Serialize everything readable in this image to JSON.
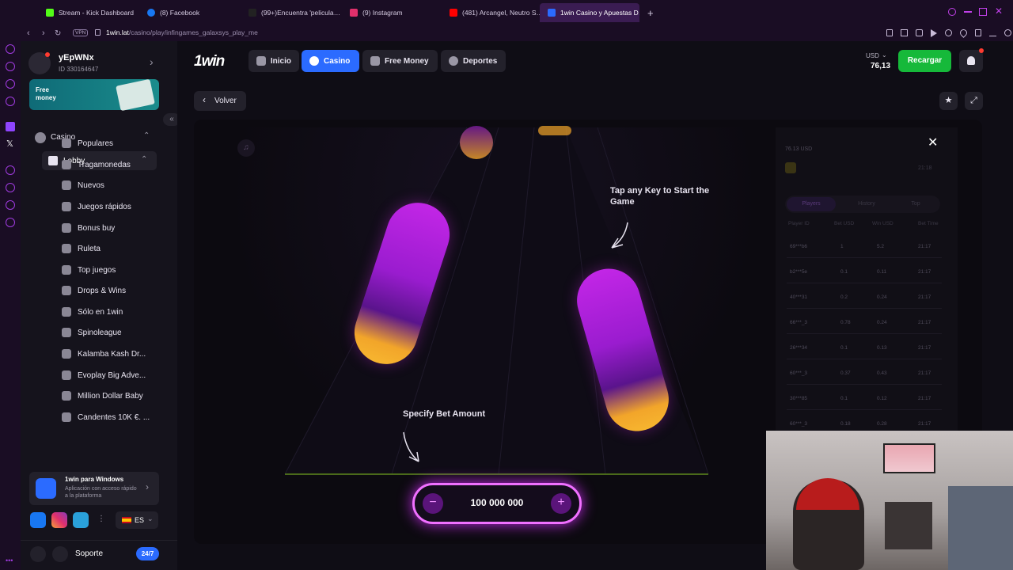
{
  "browser": {
    "tabs": [
      {
        "label": "Stream - Kick Dashboard",
        "color": "#53fc18"
      },
      {
        "label": "(8) Facebook",
        "color": "#1877f2"
      },
      {
        "label": "(99+)Encuentra 'pelicula…",
        "color": "#ffffff"
      },
      {
        "label": "(9) Instagram",
        "color": "#e1306c"
      },
      {
        "label": "(481) Arcangel, Neutro S…",
        "color": "#ff0000"
      },
      {
        "label": "1win Casino y Apuestas D…",
        "color": "#2b6bff"
      }
    ],
    "new_tab": "+",
    "vpn_badge": "VPN",
    "url_host": "1win.lat",
    "url_path": "/casino/play/infingames_galaxsys_play_me"
  },
  "sidebar": {
    "username": "yEpWNx",
    "user_id": "ID 330164647",
    "promo_label": "Free money",
    "section_casino": "Casino",
    "lobby": "Lobby",
    "items": [
      {
        "label": "Populares",
        "icon": "star-icon"
      },
      {
        "label": "Tragamonedas",
        "icon": "slot-icon"
      },
      {
        "label": "Nuevos",
        "icon": "new-icon"
      },
      {
        "label": "Juegos rápidos",
        "icon": "lightning-icon"
      },
      {
        "label": "Bonus buy",
        "icon": "bonus-icon"
      },
      {
        "label": "Ruleta",
        "icon": "roulette-icon"
      },
      {
        "label": "Top juegos",
        "icon": "trophy-icon"
      },
      {
        "label": "Drops & Wins",
        "icon": "drops-icon"
      },
      {
        "label": "Sólo en 1win",
        "icon": "1w-icon"
      },
      {
        "label": "Spinoleague",
        "icon": "league-icon"
      },
      {
        "label": "Kalamba Kash Dr...",
        "icon": "kalamba-icon"
      },
      {
        "label": "Evoplay Big Adve...",
        "icon": "evoplay-icon"
      },
      {
        "label": "Million Dollar Baby",
        "icon": "million-icon"
      },
      {
        "label": "Candentes 10K €. ...",
        "icon": "fire-icon"
      }
    ],
    "app_title": "1win para Windows",
    "app_subtitle": "Aplicación con acceso rápido a la plataforma",
    "language": "ES",
    "support_label": "Soporte",
    "support_badge": "24/7"
  },
  "header": {
    "logo": "1win",
    "nav": [
      {
        "label": "Inicio",
        "icon": "home-icon"
      },
      {
        "label": "Casino",
        "icon": "casino-icon"
      },
      {
        "label": "Free Money",
        "icon": "gift-icon"
      },
      {
        "label": "Deportes",
        "icon": "ball-icon"
      }
    ],
    "currency": "USD",
    "balance": "76,13",
    "recharge_label": "Recargar"
  },
  "toolbar": {
    "back_label": "Volver"
  },
  "game": {
    "hint_start": "Tap any Key to Start the Game",
    "hint_bet": "Specify Bet Amount",
    "bet_amount": "100 000 000",
    "minus": "−",
    "plus": "+",
    "panel_balance": "76.13 USD",
    "panel_time": "21:18",
    "panel_tabs": [
      "Players",
      "History",
      "Top"
    ],
    "table_headers": [
      "Player ID",
      "Bet USD",
      "Win USD",
      "Bet Time"
    ],
    "rows": [
      [
        "69***b6",
        "1",
        "5.2",
        "21:17"
      ],
      [
        "b2***5e",
        "0.1",
        "0.11",
        "21:17"
      ],
      [
        "40***31",
        "0.2",
        "0.24",
        "21:17"
      ],
      [
        "66***_3",
        "0.78",
        "0.24",
        "21:17"
      ],
      [
        "26***34",
        "0.1",
        "0.13",
        "21:17"
      ],
      [
        "60***_3",
        "0.37",
        "0.43",
        "21:17"
      ],
      [
        "30***85",
        "0.1",
        "0.12",
        "21:17"
      ],
      [
        "60***_3",
        "0.18",
        "0.28",
        "21:17"
      ]
    ]
  }
}
